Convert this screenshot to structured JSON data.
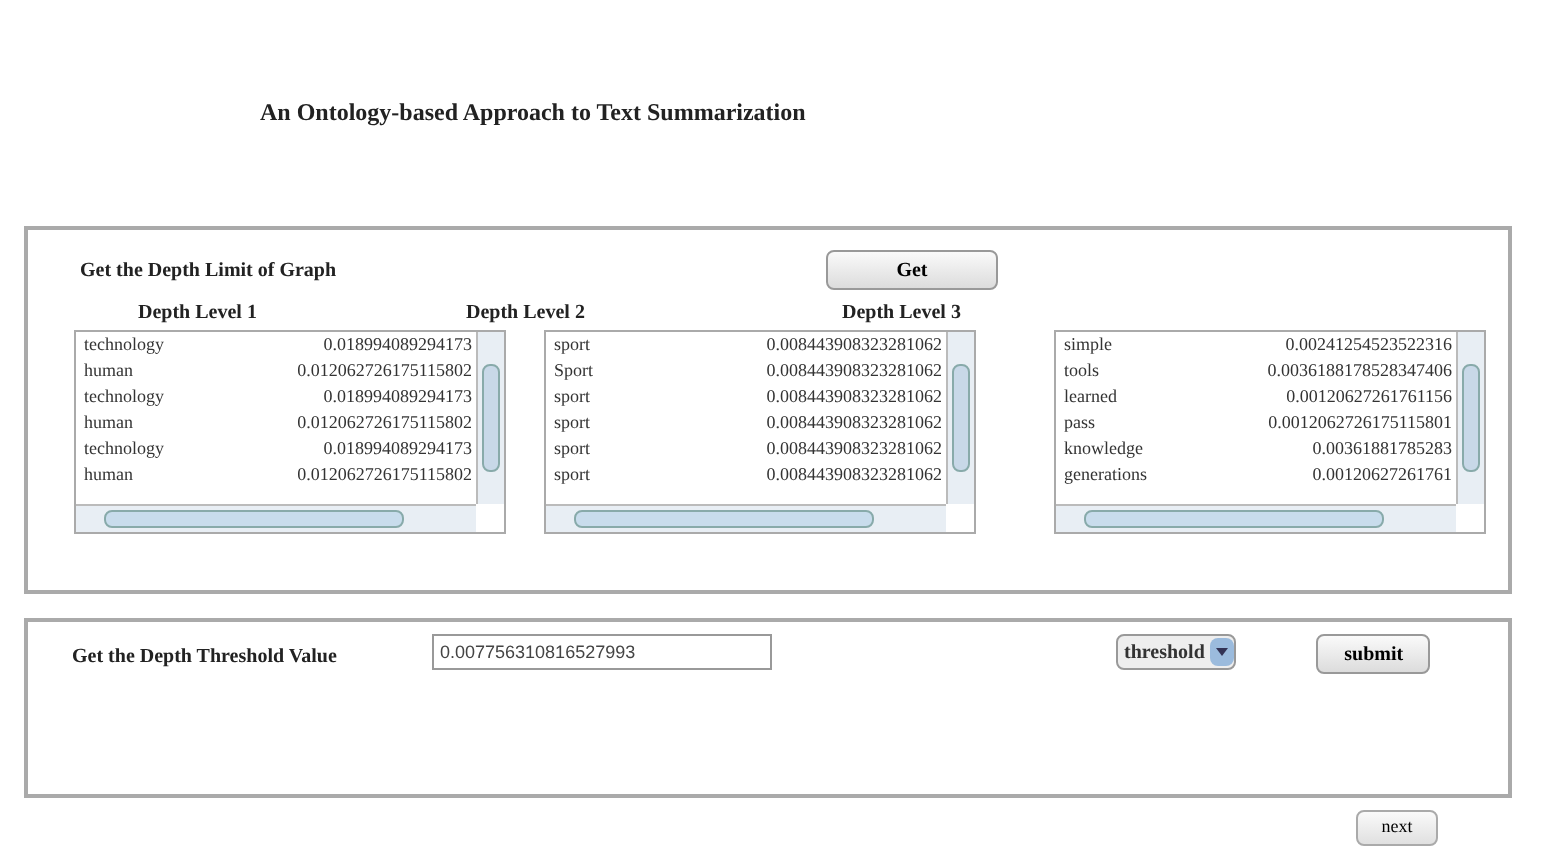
{
  "title": "An Ontology-based Approach to Text Summarization",
  "depth_limit": {
    "label": "Get the Depth Limit of Graph",
    "button": "Get",
    "lists": [
      {
        "heading": "Depth Level 1",
        "rows": [
          [
            "technology",
            "0.018994089294173"
          ],
          [
            "human",
            "0.012062726175115802"
          ],
          [
            "technology",
            "0.018994089294173"
          ],
          [
            "human",
            "0.012062726175115802"
          ],
          [
            "technology",
            "0.018994089294173"
          ],
          [
            "human",
            "0.012062726175115802"
          ]
        ]
      },
      {
        "heading": "Depth Level 2",
        "rows": [
          [
            "sport",
            "0.008443908323281062"
          ],
          [
            "Sport",
            "0.008443908323281062"
          ],
          [
            "sport",
            "0.008443908323281062"
          ],
          [
            "sport",
            "0.008443908323281062"
          ],
          [
            "sport",
            "0.008443908323281062"
          ],
          [
            "sport",
            "0.008443908323281062"
          ]
        ]
      },
      {
        "heading": "Depth Level 3",
        "rows": [
          [
            "simple",
            "0.00241254523522316"
          ],
          [
            "tools",
            "0.0036188178528347406"
          ],
          [
            "learned",
            "0.00120627261761156"
          ],
          [
            "pass",
            "0.0012062726175115801"
          ],
          [
            "knowledge",
            "0.00361881785283"
          ],
          [
            "generations",
            "0.00120627261761"
          ]
        ]
      }
    ]
  },
  "threshold": {
    "label": "Get the Depth Threshold Value",
    "value": "0.007756310816527993",
    "select": "threshold",
    "button": "submit"
  },
  "next_button": "next"
}
